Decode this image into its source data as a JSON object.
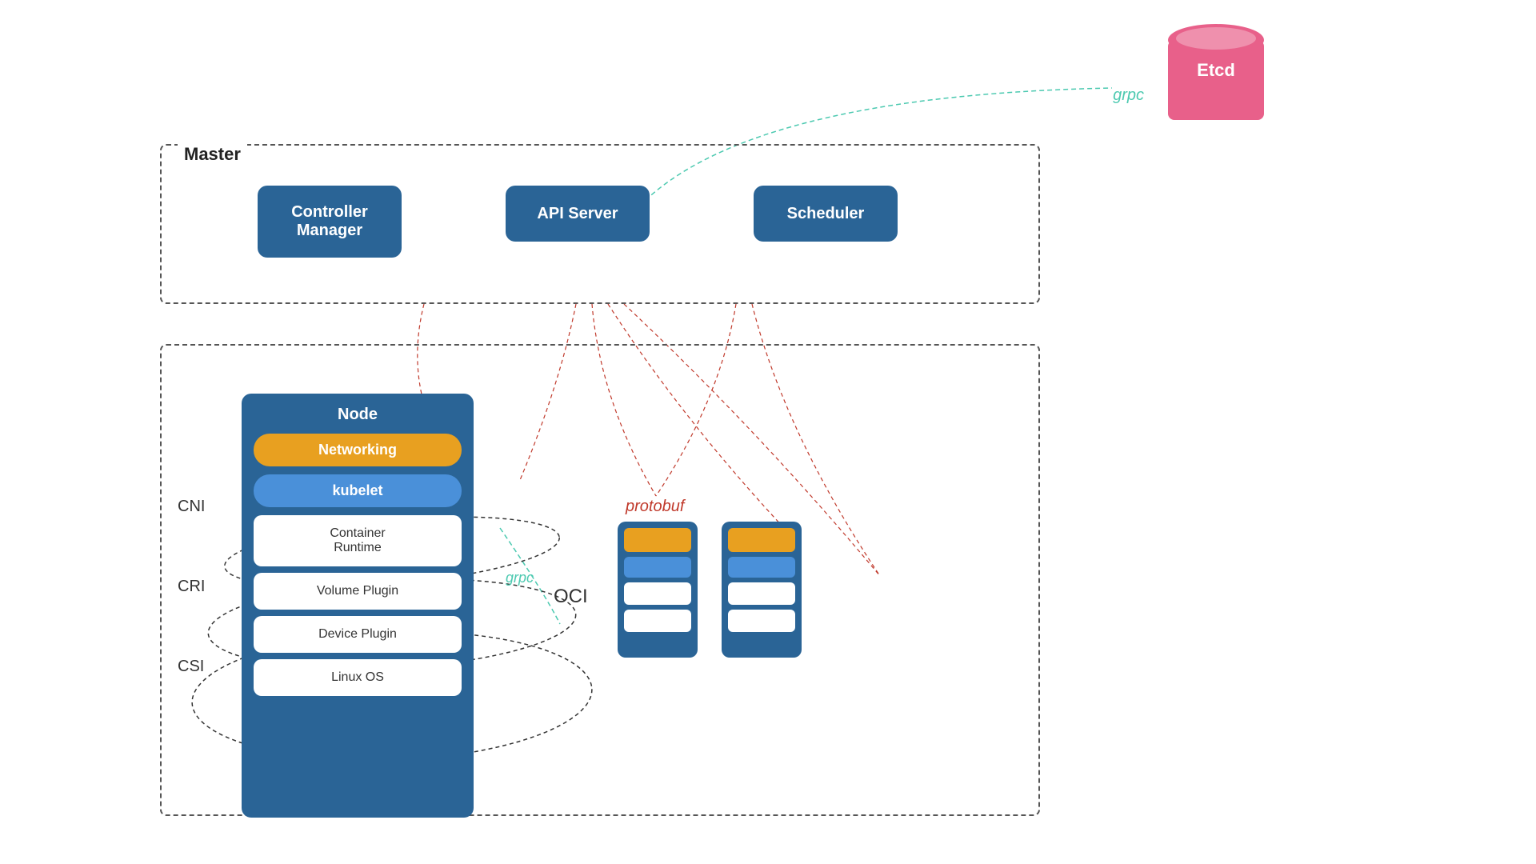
{
  "etcd": {
    "label": "Etcd",
    "color": "#e8608a"
  },
  "grpc_etcd": "grpc",
  "master": {
    "label": "Master",
    "controller_manager": "Controller\nManager",
    "api_server": "API Server",
    "scheduler": "Scheduler"
  },
  "node": {
    "label": "Node",
    "networking": "Networking",
    "kubelet": "kubelet",
    "container_runtime": "Container\nRuntime",
    "volume_plugin": "Volume Plugin",
    "device_plugin": "Device Plugin",
    "linux_os": "Linux OS"
  },
  "labels": {
    "cni": "CNI",
    "cri": "CRI",
    "csi": "CSI",
    "oci": "OCI",
    "grpc": "grpc",
    "protobuf": "protobuf"
  }
}
